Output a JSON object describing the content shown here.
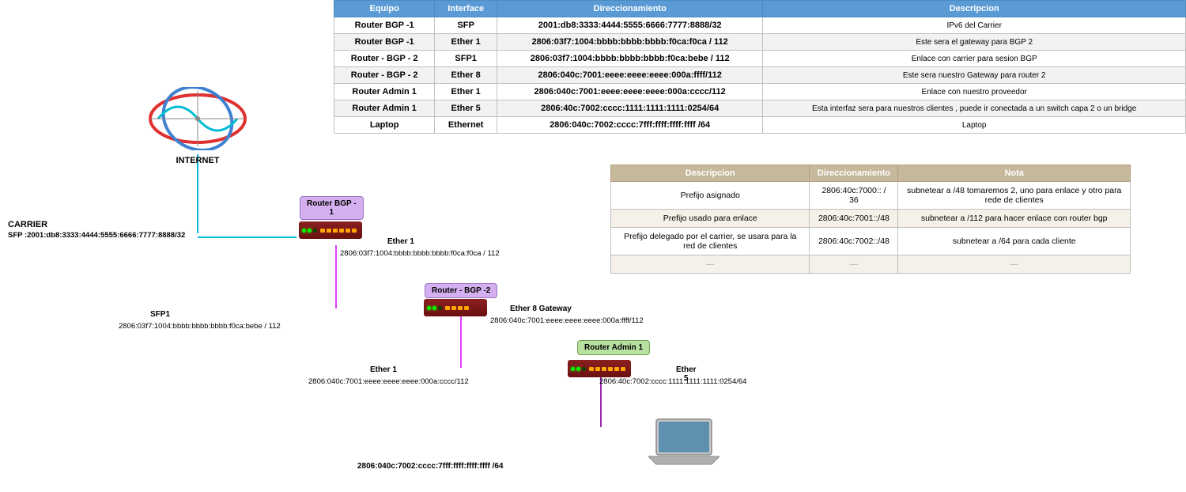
{
  "tables": {
    "main": {
      "headers": [
        "Equipo",
        "Interface",
        "Direccionamiento",
        "Descripcion"
      ],
      "rows": [
        [
          "Router BGP -1",
          "SFP",
          "2001:db8:3333:4444:5555:6666:7777:8888/32",
          "IPv6 del Carrier"
        ],
        [
          "Router BGP -1",
          "Ether 1",
          "2806:03f7:1004:bbbb:bbbb:bbbb:f0ca:f0ca / 112",
          "Este sera el gateway para BGP 2"
        ],
        [
          "Router - BGP - 2",
          "SFP1",
          "2806:03f7:1004:bbbb:bbbb:bbbb:f0ca:bebe / 112",
          "Enlace con carrier para sesion BGP"
        ],
        [
          "Router - BGP - 2",
          "Ether 8",
          "2806:040c:7001:eeee:eeee:eeee:000a:ffff/112",
          "Este sera nuestro Gateway para router 2"
        ],
        [
          "Router Admin 1",
          "Ether 1",
          "2806:040c:7001:eeee:eeee:eeee:000a:cccc/112",
          "Enlace con nuestro proveedor"
        ],
        [
          "Router Admin 1",
          "Ether 5",
          "2806:40c:7002:cccc:1111:1111:1111:0254/64",
          "Esta interfaz sera para nuestros clientes , puede ir conectada a un switch capa 2 o un bridge"
        ],
        [
          "Laptop",
          "Ethernet",
          "2806:040c:7002:cccc:7fff:ffff:ffff:ffff /64",
          "Laptop"
        ]
      ]
    },
    "second": {
      "headers": [
        "Descripcion",
        "Direccionamiento",
        "Nota"
      ],
      "rows": [
        [
          "Prefijo asignado",
          "2806:40c:7000:: / 36",
          "subnetear a /48  tomaremos 2, uno para enlace y otro para rede de clientes"
        ],
        [
          "Prefijo usado para enlace",
          "2806:40c:7001::/48",
          "subnetear a /112 para hacer enlace con router bgp"
        ],
        [
          "Prefijo delegado por el carrier, se usara para la red de clientes",
          "2806:40c:7002::/48",
          "subnetear a /64 para cada cliente"
        ],
        [
          "—",
          "—",
          "—"
        ]
      ]
    }
  },
  "diagram": {
    "internet_label": "INTERNET",
    "carrier_label": "CARRIER",
    "carrier_sfp": "SFP :2001:db8:3333:4444:5555:6666:7777:8888/32",
    "router_bgp1_label": "Router BGP -\n1",
    "router_bgp2_label": "Router - BGP -2",
    "router_admin1_label": "Router Admin 1",
    "ether1_bgp1": "Ether 1",
    "ether1_bgp1_addr": "2806:03f7:1004:bbbb:bbbb:bbbb:f0ca:f0ca / 112",
    "sfp1_bgp2": "SFP1",
    "sfp1_bgp2_addr": "2806:03f7:1004:bbbb:bbbb:bbbb:f0ca:bebe / 112",
    "ether8_label": "Ether 8 Gateway",
    "ether8_addr": "2806:040c:7001:eeee:eeee:eeee:000a:ffff/112",
    "ether1_admin": "Ether 1",
    "ether1_admin_addr": "2806:040c:7001:eeee:eeee:eeee:000a:cccc/112",
    "ether5_label": "Ether 5",
    "ether5_addr": "2806:40c:7002:cccc:1111:1111:1111:0254/64",
    "laptop_addr": "2806:040c:7002:cccc:7fff:ffff:ffff:ffff /64"
  }
}
